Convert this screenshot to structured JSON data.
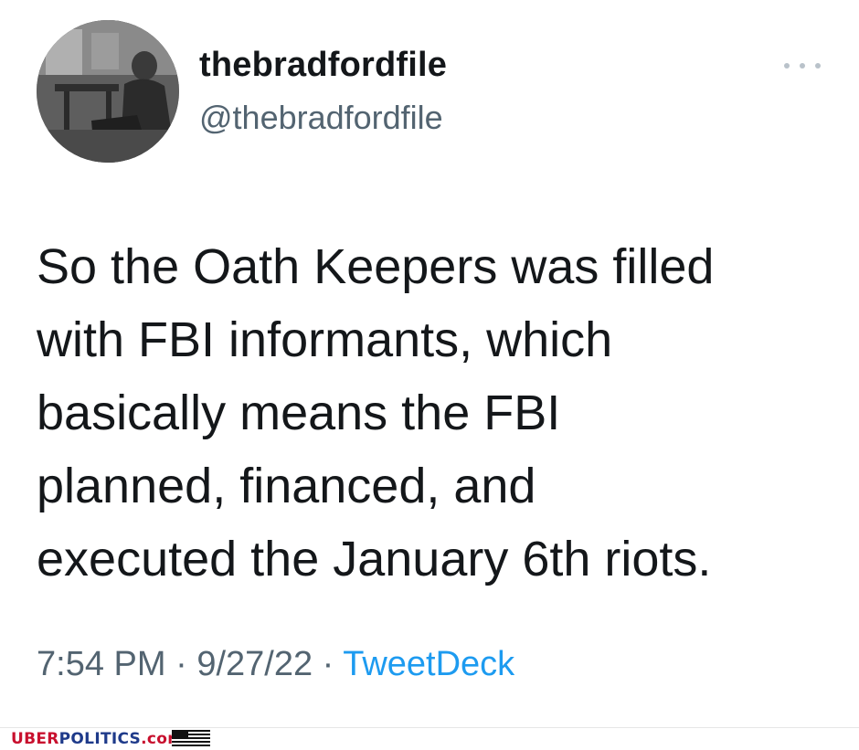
{
  "tweet": {
    "display_name": "thebradfordfile",
    "handle": "@thebradfordfile",
    "text": "So the Oath Keepers was filled\nwith FBI informants, which\nbasically means the FBI\nplanned, financed, and\nexecuted the January 6th riots.",
    "time": "7:54 PM",
    "separator": " · ",
    "date": "9/27/22",
    "source": "TweetDeck",
    "more_icon": "more-dots-icon",
    "source_color": "#1d9bf0"
  },
  "watermark": {
    "part_red": "UBER",
    "part_blue": "POLITICS",
    "part_red2": ".com",
    "flag_icon": "us-flag-icon"
  }
}
